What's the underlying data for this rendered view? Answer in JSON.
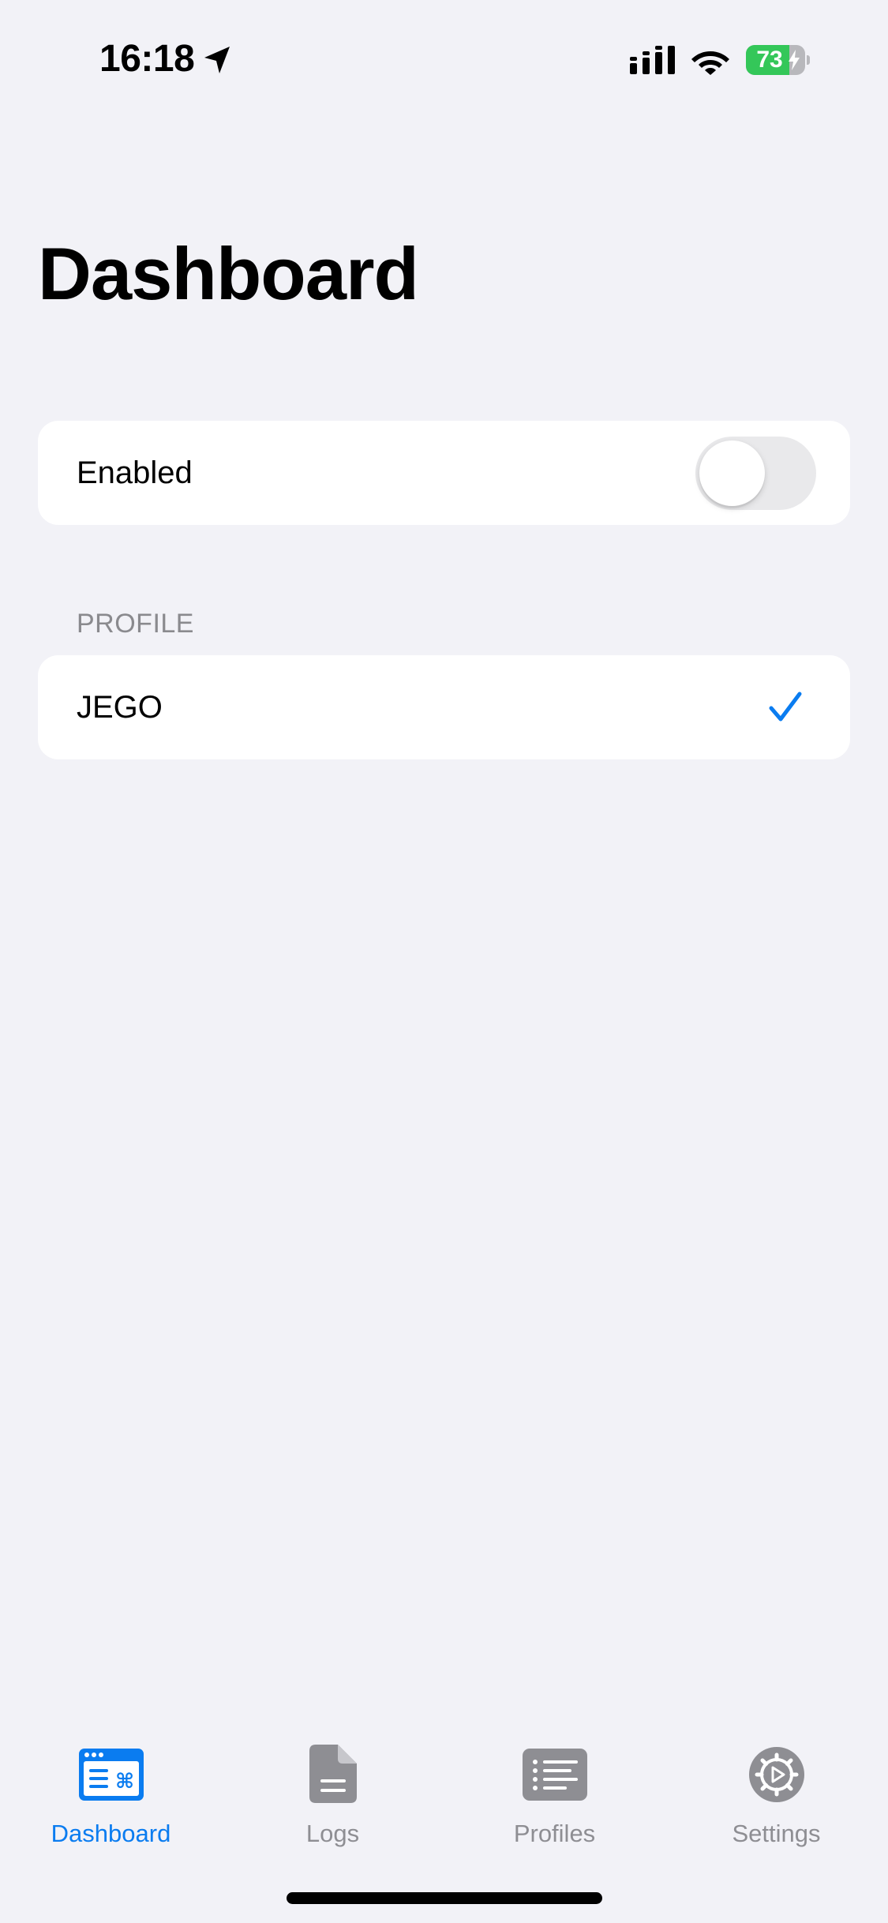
{
  "status_bar": {
    "time": "16:18",
    "battery_level": "73",
    "battery_fraction": 0.73,
    "icons": [
      "location-arrow-icon",
      "cellular-signal-icon",
      "wifi-icon",
      "battery-charging-icon"
    ]
  },
  "page": {
    "title": "Dashboard"
  },
  "enabled_row": {
    "label": "Enabled",
    "toggle_on": false
  },
  "profile_section": {
    "header": "PROFILE",
    "items": [
      {
        "label": "JEGO",
        "selected": true,
        "icon": "checkmark-icon"
      }
    ]
  },
  "tab_bar": {
    "tabs": [
      {
        "label": "Dashboard",
        "icon": "dashboard-icon",
        "active": true
      },
      {
        "label": "Logs",
        "icon": "document-icon",
        "active": false
      },
      {
        "label": "Profiles",
        "icon": "list-icon",
        "active": false
      },
      {
        "label": "Settings",
        "icon": "gear-icon",
        "active": false
      }
    ]
  },
  "colors": {
    "accent": "#0a7cf0",
    "inactive": "#8e8e93",
    "background": "#f2f2f7",
    "battery_green": "#34c759"
  }
}
